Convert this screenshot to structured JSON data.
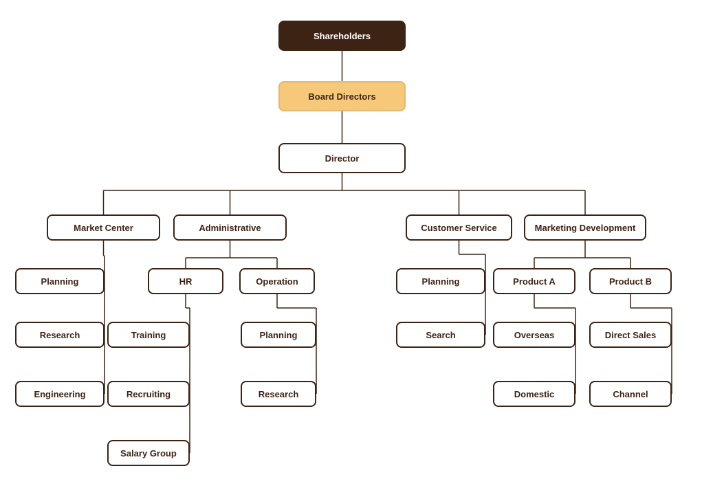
{
  "nodes": {
    "shareholders": {
      "label": "Shareholders"
    },
    "board_directors": {
      "label": "Board Directors"
    },
    "director": {
      "label": "Director"
    },
    "market_center": {
      "label": "Market Center"
    },
    "administrative": {
      "label": "Administrative"
    },
    "customer_service": {
      "label": "Customer Service"
    },
    "marketing_development": {
      "label": "Marketing Development"
    },
    "planning_left": {
      "label": "Planning"
    },
    "research": {
      "label": "Research"
    },
    "engineering": {
      "label": "Engineering"
    },
    "hr": {
      "label": "HR"
    },
    "operation": {
      "label": "Operation"
    },
    "training": {
      "label": "Training"
    },
    "recruiting": {
      "label": "Recruiting"
    },
    "salary_group": {
      "label": "Salary Group"
    },
    "planning_op": {
      "label": "Planning"
    },
    "research_op": {
      "label": "Research"
    },
    "planning_cs": {
      "label": "Planning"
    },
    "search": {
      "label": "Search"
    },
    "product_a": {
      "label": "Product A"
    },
    "product_b": {
      "label": "Product B"
    },
    "overseas": {
      "label": "Overseas"
    },
    "direct_sales": {
      "label": "Direct Sales"
    },
    "domestic": {
      "label": "Domestic"
    },
    "channel": {
      "label": "Channel"
    }
  }
}
